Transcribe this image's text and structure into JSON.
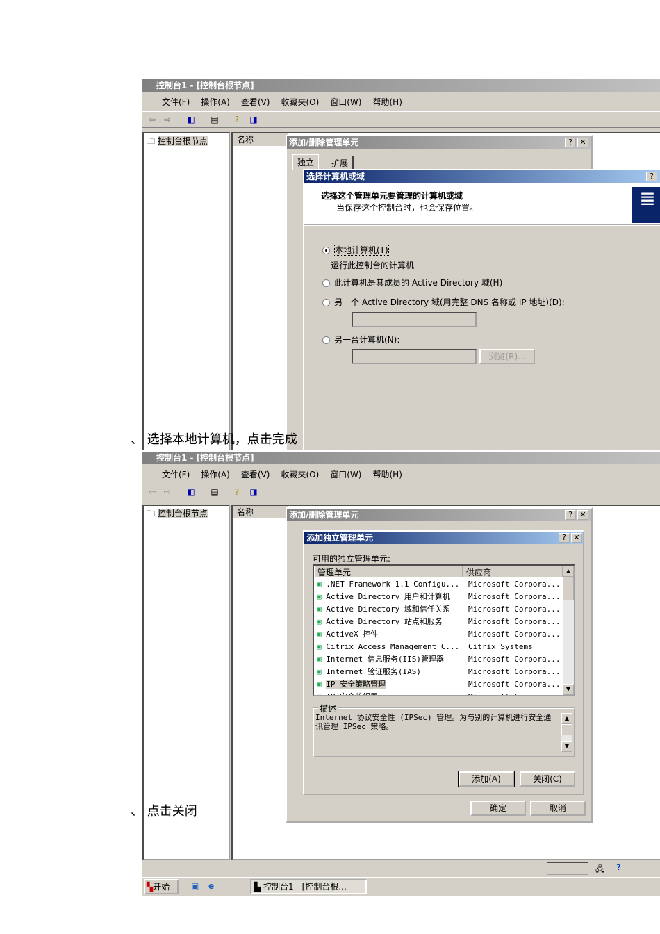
{
  "window": {
    "title": "控制台1 - [控制台根节点]",
    "menu": [
      "文件(F)",
      "操作(A)",
      "查看(V)",
      "收藏夹(O)",
      "窗口(W)",
      "帮助(H)"
    ],
    "tree_root": "控制台根节点",
    "col_name": "名称"
  },
  "addremove": {
    "title": "添加/删除管理单元",
    "tabs": [
      "独立",
      "扩展"
    ],
    "ok": "确定",
    "cancel": "取消"
  },
  "select_computer": {
    "title": "选择计算机或域",
    "heading": "选择这个管理单元要管理的计算机或域",
    "sub": "当保存这个控制台时，也会保存位置。",
    "opt_local": "本地计算机(T)",
    "opt_local_desc": "运行此控制台的计算机",
    "opt_member": "此计算机是其成员的 Active Directory 域(H)",
    "opt_other_domain": "另一个 Active Directory 域(用完整 DNS 名称或 IP 地址)(D):",
    "opt_other_computer": "另一台计算机(N):",
    "browse": "浏览(R)..."
  },
  "caption1": "、 选择本地计算机，点击完成",
  "caption2": "、 点击关闭",
  "standalone": {
    "title": "添加独立管理单元",
    "label": "可用的独立管理单元:",
    "col_snapin": "管理单元",
    "col_vendor": "供应商",
    "rows": [
      {
        "name": ".NET Framework 1.1 Configu...",
        "vendor": "Microsoft Corpora..."
      },
      {
        "name": "Active Directory 用户和计算机",
        "vendor": "Microsoft Corpora..."
      },
      {
        "name": "Active Directory 域和信任关系",
        "vendor": "Microsoft Corpora..."
      },
      {
        "name": "Active Directory 站点和服务",
        "vendor": "Microsoft Corpora..."
      },
      {
        "name": "ActiveX 控件",
        "vendor": "Microsoft Corpora..."
      },
      {
        "name": "Citrix Access Management C...",
        "vendor": "Citrix Systems"
      },
      {
        "name": "Internet 信息服务(IIS)管理器",
        "vendor": "Microsoft Corpora..."
      },
      {
        "name": "Internet 验证服务(IAS)",
        "vendor": "Microsoft Corpora..."
      },
      {
        "name": "IP 安全策略管理",
        "vendor": "Microsoft Corpora...",
        "selected": true
      },
      {
        "name": "IP 安全监视器",
        "vendor": "Microsoft Corpora..."
      }
    ],
    "desc_label": "描述",
    "desc": "Internet 协议安全性 (IPSec) 管理。为与别的计算机进行安全通讯管理 IPSec 策略。",
    "add": "添加(A)",
    "close": "关闭(C)"
  },
  "taskbar": {
    "start": "开始",
    "task": "控制台1 - [控制台根..."
  }
}
